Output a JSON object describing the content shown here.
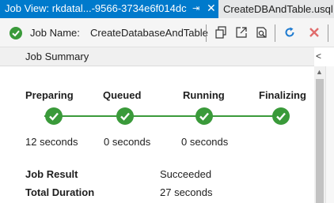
{
  "tabs": {
    "active_title": "Job View: rkdatal...-9566-3734e6f014dc",
    "pin_icon": "pin-icon",
    "close_icon": "close-icon",
    "inactive_title": "CreateDBAndTable.usql"
  },
  "toolbar": {
    "job_name_label": "Job Name:",
    "job_name_value": "CreateDatabaseAndTable",
    "icons": [
      "status-check-icon",
      "copy-icon",
      "open-external-icon",
      "search-script-icon",
      "refresh-icon",
      "cancel-icon"
    ]
  },
  "summary": {
    "header": "Job Summary",
    "stages": [
      "Preparing",
      "Queued",
      "Running",
      "Finalizing"
    ],
    "durations": [
      "12 seconds",
      "0 seconds",
      "0 seconds"
    ],
    "job_result_label": "Job Result",
    "job_result_value": "Succeeded",
    "total_duration_label": "Total Duration",
    "total_duration_value": "27 seconds"
  },
  "colors": {
    "accent": "#007acc",
    "success": "#3a9a3a",
    "cancel": "#e06c6c",
    "refresh": "#1e7bd0"
  }
}
